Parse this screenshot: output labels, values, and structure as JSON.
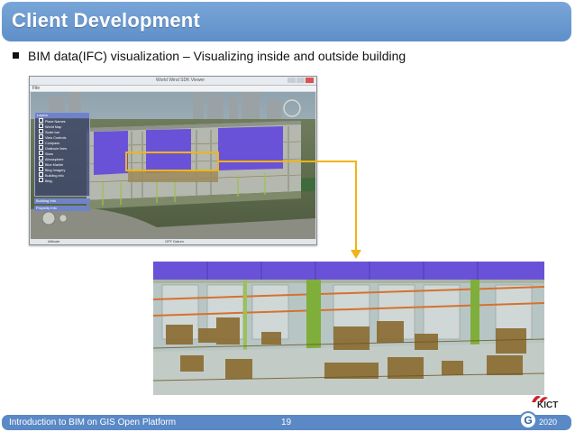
{
  "slide": {
    "title": "Client Development",
    "bullet": "BIM data(IFC) visualization – Visualizing inside and outside building",
    "footer_text": "Introduction to BIM on GIS Open Platform",
    "page_number": "19",
    "footer_code": "2020",
    "logo_text": "KICT",
    "footer_logo_letter": "G"
  },
  "screenshot": {
    "window_title": "World Wind SDK Viewer",
    "menu_text": "File",
    "layer_panel_title": "Layers",
    "layers": [
      "Place Names",
      "World Map",
      "Scale bar",
      "View Controls",
      "Compass",
      "Graticule lines",
      "Stars",
      "Atmosphere",
      "Blue Marble",
      "Bing Imagery",
      "Building info",
      "Bldg."
    ],
    "panels": [
      "Building Info",
      "Property Info"
    ],
    "status_left": "Altitude",
    "status_right": "OFF Datum"
  },
  "colors": {
    "title_bar": "#6b99d1",
    "footer_bar": "#5a89c6",
    "highlight": "#f0b416",
    "facade_purple": "#6a52d8"
  }
}
